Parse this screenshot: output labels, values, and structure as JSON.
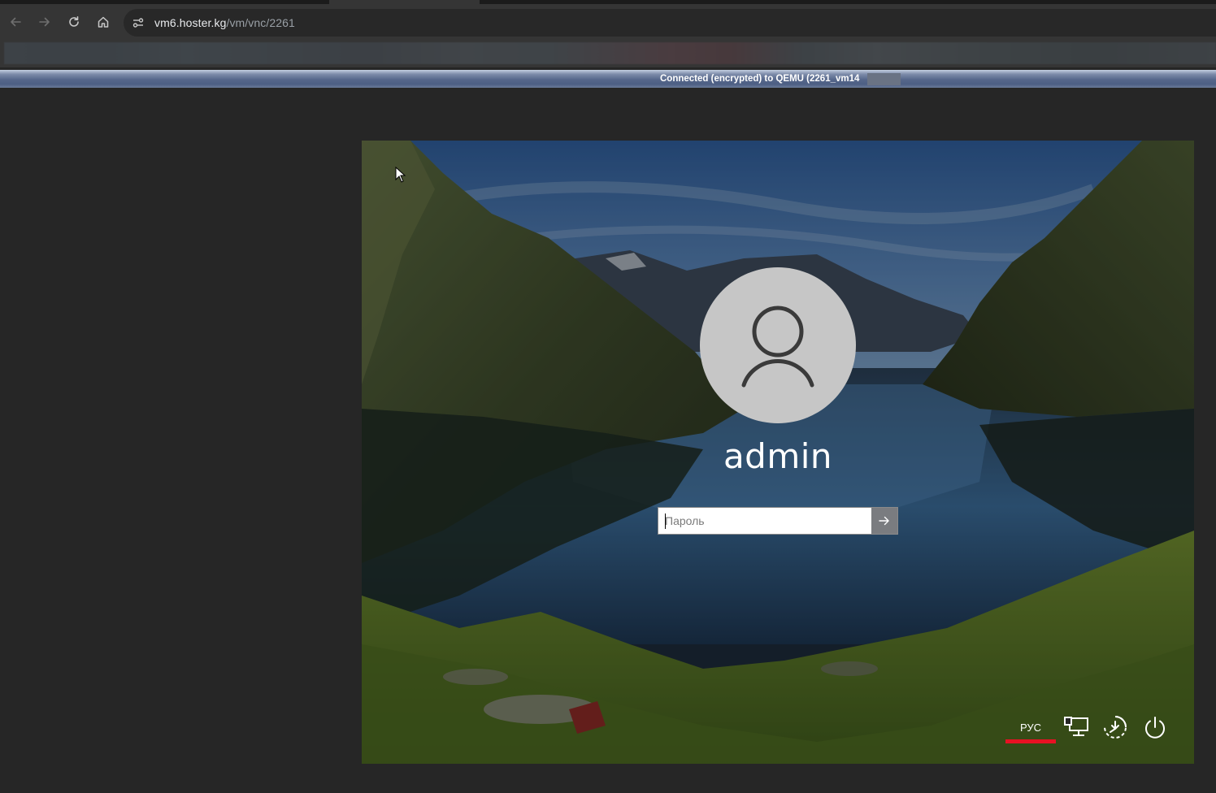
{
  "browser": {
    "url_host": "vm6.hoster.kg",
    "url_path": "/vm/vnc/2261"
  },
  "vnc": {
    "status_text": "Connected (encrypted) to QEMU (2261_vm14"
  },
  "login": {
    "username": "admin",
    "password_placeholder": "Пароль",
    "language_indicator": "РУС"
  },
  "icons": {
    "back": "back-arrow-icon",
    "forward": "forward-arrow-icon",
    "reload": "reload-icon",
    "home": "home-icon",
    "site_info": "site-settings-icon",
    "avatar": "user-avatar-icon",
    "submit": "arrow-right-icon",
    "network": "network-icon",
    "accessibility": "accessibility-icon",
    "power": "power-icon"
  },
  "colors": {
    "language_underline": "#e81123",
    "chrome_toolbar": "#353535",
    "page_background": "#262626"
  }
}
